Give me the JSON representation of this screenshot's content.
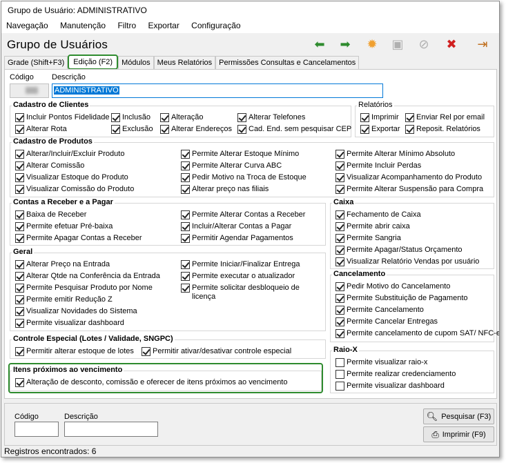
{
  "window": {
    "title": "Grupo de Usuário: ADMINISTRATIVO"
  },
  "menu": [
    "Navegação",
    "Manutenção",
    "Filtro",
    "Exportar",
    "Configuração"
  ],
  "form_title": "Grupo de Usuários",
  "toolbar": {
    "icons": [
      "arrow-left-icon",
      "arrow-right-icon",
      "new-icon",
      "save-icon",
      "cancel-icon",
      "delete-icon",
      "exit-icon"
    ]
  },
  "tabs": [
    "Grade (Shift+F3)",
    "Edição (F2)",
    "Módulos",
    "Meus Relatórios",
    "Permissões Consultas e Cancelamentos"
  ],
  "fields": {
    "codigo_label": "Código",
    "descricao_label": "Descrição",
    "descricao_value": "ADMINISTRATIVO"
  },
  "groups": {
    "cadastro_clientes": {
      "title": "Cadastro de Clientes",
      "items": [
        "Incluir Pontos Fidelidade",
        "Inclusão",
        "Alteração",
        "Alterar Telefones",
        "Alterar Rota",
        "Exclusão",
        "Alterar Endereços",
        "Cad. End. sem pesquisar CEP"
      ]
    },
    "relatorios": {
      "title": "Relatórios",
      "items": [
        "Imprimir",
        "Enviar Rel por email",
        "Exportar",
        "Reposit. Relatórios"
      ]
    },
    "cadastro_produtos": {
      "title": "Cadastro de Produtos",
      "items": [
        "Alterar/Incluir/Excluir Produto",
        "Alterar Comissão",
        "Visualizar Estoque do Produto",
        "Visualizar Comissão do Produto",
        "Permite Alterar Estoque Mínimo",
        "Permite Alterar Curva ABC",
        "Pedir Motivo na Troca de Estoque",
        "Alterar preço nas filiais",
        "Permite Alterar Mínimo Absoluto",
        "Permite Incluir Perdas",
        "Visualizar Acompanhamento do Produto",
        "Permite Alterar Suspensão para Compra"
      ]
    },
    "contas": {
      "title": "Contas a Receber e a Pagar",
      "items": [
        "Baixa de Receber",
        "Permite efetuar Pré-baixa",
        "Permite Apagar Contas a Receber",
        "Permite Alterar Contas a Receber",
        "Incluir/Alterar Contas a Pagar",
        "Permitir Agendar Pagamentos"
      ]
    },
    "caixa": {
      "title": "Caixa",
      "items": [
        "Fechamento de Caixa",
        "Permite abrir caixa",
        "Permite Sangria",
        "Permite Apagar/Status Orçamento",
        "Visualizar Relatório Vendas por usuário"
      ]
    },
    "geral": {
      "title": "Geral",
      "items": [
        "Alterar Preço na Entrada",
        "Alterar Qtde na Conferência da Entrada",
        "Permite Pesquisar Produto por Nome",
        "Permite emitir Redução Z",
        "Visualizar Novidades do Sistema",
        "Permite visualizar dashboard",
        "Permite Iniciar/Finalizar Entrega",
        "Permite executar o atualizador",
        "Permite solicitar desbloqueio de",
        "licença"
      ]
    },
    "cancelamento": {
      "title": "Cancelamento",
      "items": [
        "Pedir Motivo do Cancelamento",
        "Permite Substituição de Pagamento",
        "Permite Cancelamento",
        "Permite Cancelar Entregas",
        "Permite cancelamento de cupom SAT/ NFC-e"
      ]
    },
    "controle": {
      "title": "Controle Especial (Lotes / Validade, SNGPC)",
      "items": [
        "Permitir alterar estoque de lotes",
        "Permitir ativar/desativar controle especial"
      ]
    },
    "raiox": {
      "title": "Raio-X",
      "items": [
        "Permite visualizar raio-x",
        "Permite realizar credenciamento",
        "Permite visualizar dashboard"
      ]
    },
    "itens": {
      "title": "Itens próximos ao vencimento",
      "items": [
        "Alteração de desconto, comissão e oferecer de itens próximos ao vencimento"
      ]
    }
  },
  "bottom": {
    "codigo_label": "Código",
    "descricao_label": "Descrição",
    "search_button": "Pesquisar (F3)",
    "print_button": "Imprimir (F9)"
  },
  "status": "Registros encontrados: 6"
}
